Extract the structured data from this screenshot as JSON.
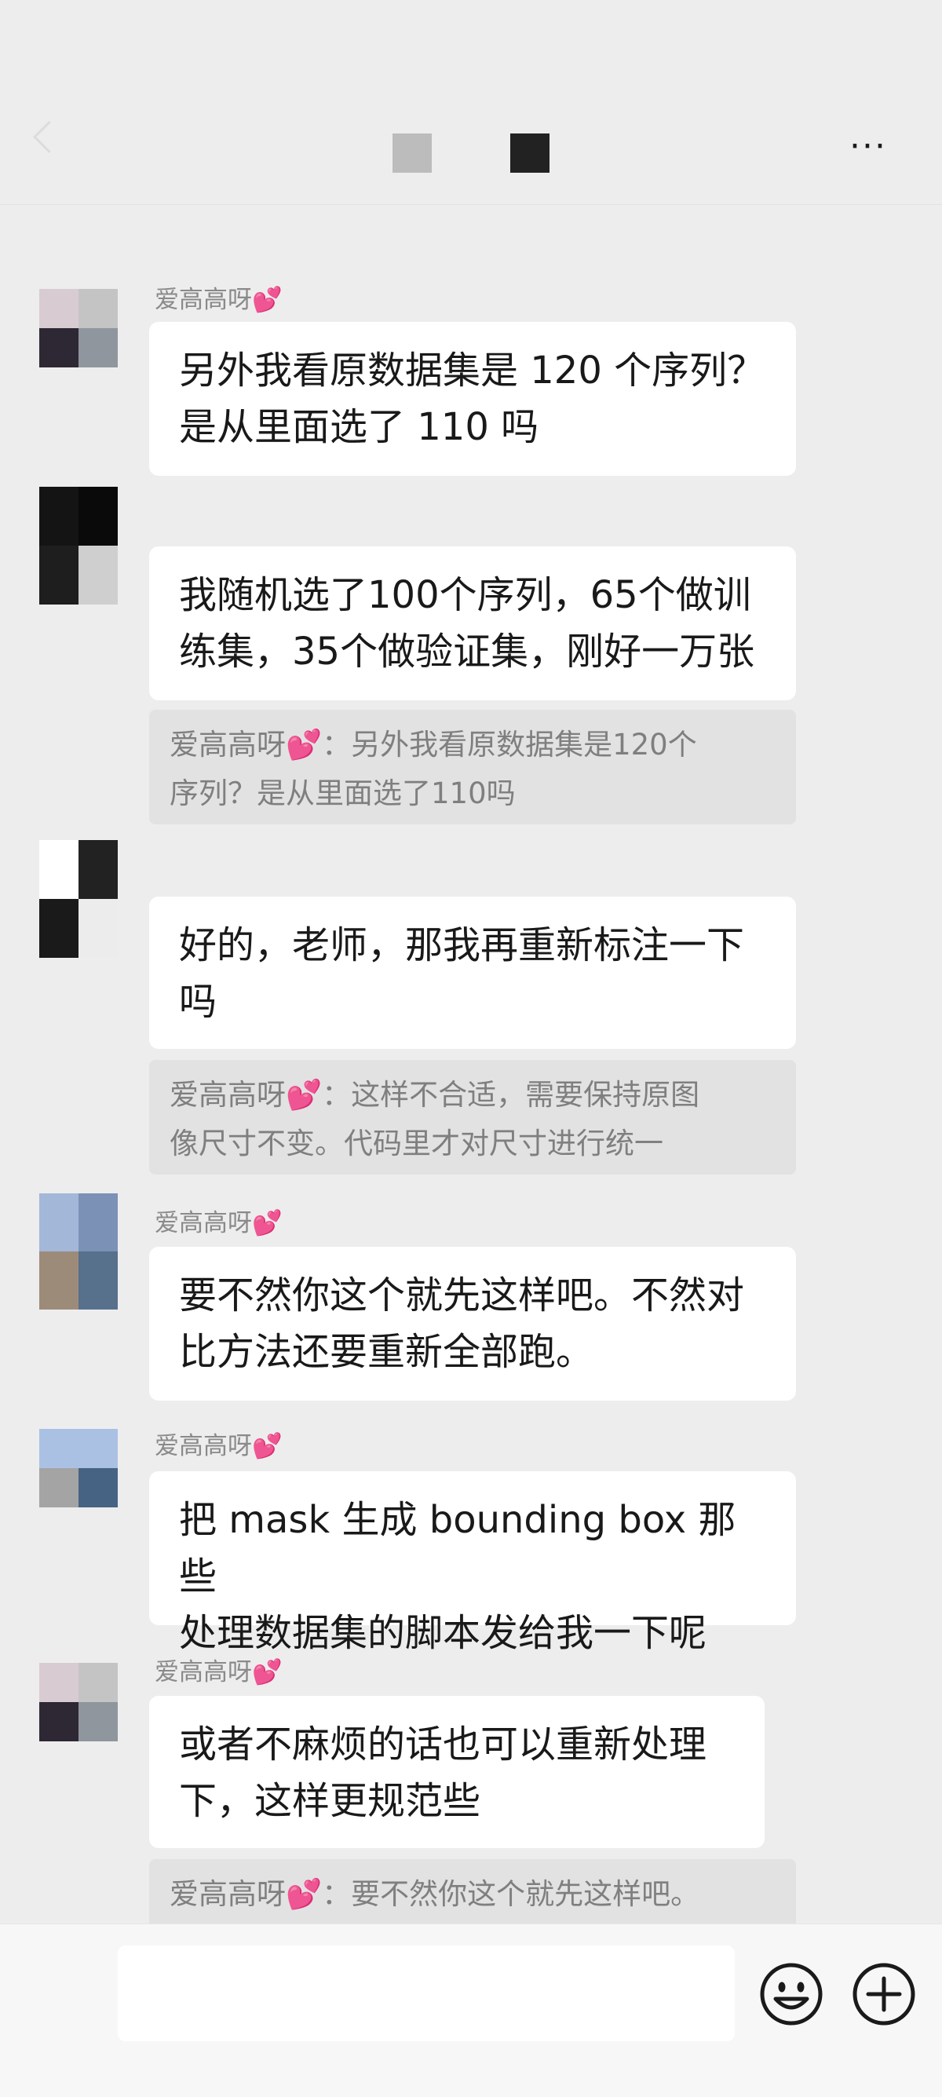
{
  "header": {
    "title_redacted": true,
    "more_label": "···"
  },
  "messages": [
    {
      "sender": "爱高高呀",
      "heart": "💕",
      "show_name": true,
      "avatar": [
        "#d8ccd2",
        "#c4c4c4",
        "#2e2734",
        "#8f969d"
      ],
      "lines": [
        "另外我看原数据集是 120 个序列？",
        "是从里面选了 110 吗"
      ]
    },
    {
      "sender": "",
      "show_name": false,
      "avatar": [
        "#141414",
        "#0a0a0a",
        "#1e1e1e",
        "#cfcfcf"
      ],
      "lines": [
        "我随机选了100个序列，65个做训",
        "练集，35个做验证集，刚好一万张"
      ],
      "quote": {
        "lines": [
          "爱高高呀💕：另外我看原数据集是120个",
          "序列？是从里面选了110吗"
        ]
      }
    },
    {
      "sender": "",
      "show_name": false,
      "avatar": [
        "#ffffff",
        "#222222",
        "#1a1a1a",
        "#ececec"
      ],
      "lines": [
        "好的，老师，那我再重新标注一下",
        "吗"
      ],
      "quote": {
        "lines": [
          "爱高高呀💕：这样不合适，需要保持原图",
          "像尺寸不变。代码里才对尺寸进行统一"
        ]
      }
    },
    {
      "sender": "爱高高呀",
      "heart": "💕",
      "show_name": true,
      "avatar": [
        "#a3b7d8",
        "#7b92b6",
        "#9d8b7a",
        "#57708b"
      ],
      "lines": [
        "要不然你这个就先这样吧。不然对",
        "比方法还要重新全部跑。"
      ]
    },
    {
      "sender": "爱高高呀",
      "heart": "💕",
      "show_name": true,
      "avatar": [
        "#aac1e3",
        "#aac1e3",
        "#a4a4a4",
        "#476383"
      ],
      "lines": [
        "把 mask 生成 bounding box 那些",
        "处理数据集的脚本发给我一下呢"
      ]
    },
    {
      "sender": "爱高高呀",
      "heart": "💕",
      "show_name": true,
      "avatar": [
        "#d8ccd2",
        "#c4c4c4",
        "#2e2734",
        "#8f969d"
      ],
      "lines": [
        "或者不麻烦的话也可以重新处理",
        "下，这样更规范些"
      ],
      "quote": {
        "lines": [
          "爱高高呀💕：要不然你这个就先这样吧。"
        ]
      }
    }
  ],
  "footer": {
    "input_value": "",
    "emoji_icon": "smiley-icon",
    "plus_icon": "plus-circle-icon"
  }
}
